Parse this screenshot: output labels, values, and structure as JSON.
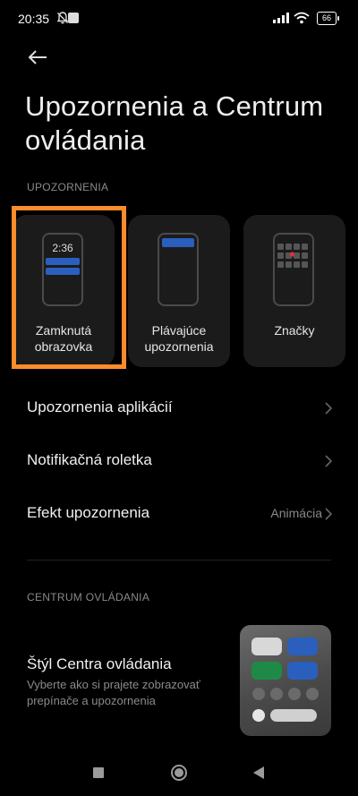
{
  "status": {
    "time": "20:35",
    "battery": "66"
  },
  "title": "Upozornenia a Centrum ovládania",
  "section_notifications": "UPOZORNENIA",
  "cards": [
    {
      "label": "Zamknutá obrazovka",
      "clock": "2:36",
      "selected": true
    },
    {
      "label": "Plávajúce upozornenia"
    },
    {
      "label": "Značky"
    }
  ],
  "rows": [
    {
      "label": "Upozornenia aplikácií",
      "value": ""
    },
    {
      "label": "Notifikačná roletka",
      "value": ""
    },
    {
      "label": "Efekt upozornenia",
      "value": "Animácia"
    }
  ],
  "section_control": "CENTRUM OVLÁDANIA",
  "control_style": {
    "label": "Štýl Centra ovládania",
    "description": "Vyberte ako si prajete zobrazovať prepínače a upozornenia"
  },
  "colors": {
    "accent_blue": "#2a5fbd",
    "accent_green": "#1f8a48",
    "highlight": "#ff8c2b"
  }
}
